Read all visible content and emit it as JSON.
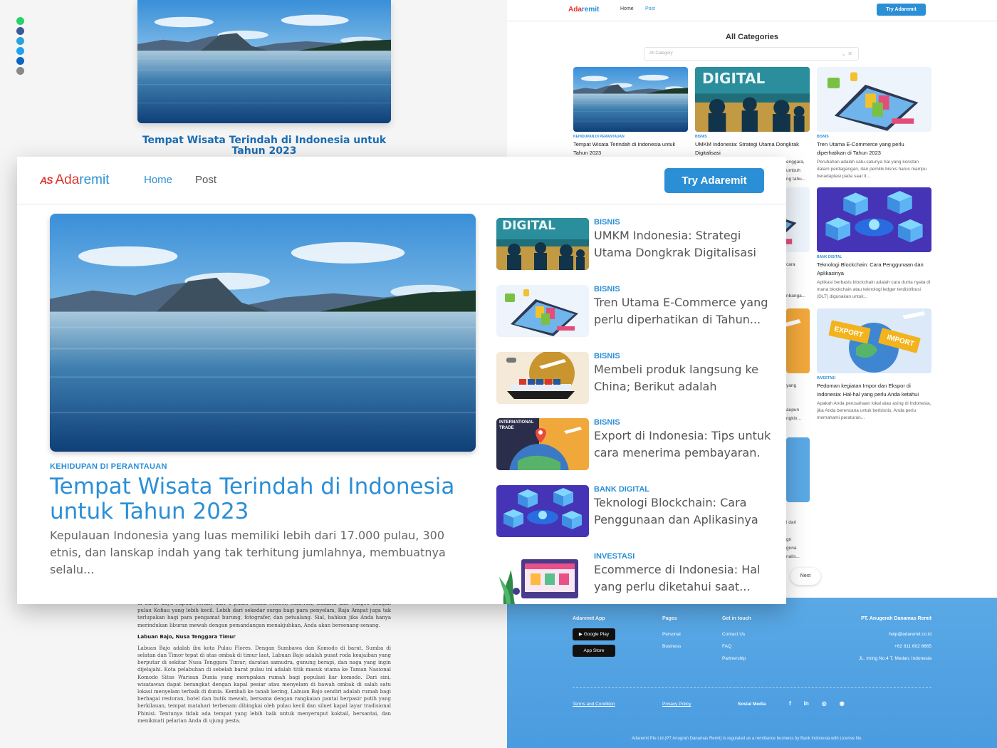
{
  "left_page": {
    "hero_title": "Tempat Wisata Terindah di Indonesia untuk Tahun 2023",
    "body_paragraph_1": "di barat daya Papua. Terdiri dari 4 pulau utama Misool, Salawati, Batanta dan Waigeo dengan pulau Kofiau yang lebih kecil. Lebih dari sekedar surga bagi para penyelam, Raja Ampat juga tak terlupakan bagi para pengamat burung, fotografer, dan petualang. Sial, bahkan jika Anda hanya merindukan liburan mewah dengan pemandangan menakjubkan, Anda akan bersenang-senang.",
    "subheading": "Labuan Bajo, Nusa Tenggara Timur",
    "body_paragraph_2": "Labuan Bajo adalah ibu kota Pulau Flores. Dengan Sumbawa dan Komodo di barat, Sumba di selatan dan Timor tepat di atas ombak di timur laut, Labuan Bajo adalah pusat roda keajaiban yang berputar di sekitar Nusa Tenggara Timur; daratan samudra, gunung berapi, dan naga yang ingin dijelajahi. Kota pelabuhan di sebelah barat pulau ini adalah titik masuk utama ke Taman Nasional Komodo Situs Warisan Dunia yang merupakan rumah bagi populasi liar komodo. Dari sini, wisatawan dapat berangkat dengan kapal pesiar atau menyelam di bawah ombak di salah satu lokasi menyelam terbaik di dunia. Kembali ke tanah kering, Labuan Bajo sendiri adalah rumah bagi berbagai restoran, hotel dan butik mewah, bersama dengan rangkaian pantai berpasir putih yang berkilauan, tempat matahari terbenam dibingkai oleh pulau kecil dan siluet kapal layar tradisional Phinisi. Tentunya tidak ada tempat yang lebih baik untuk menyeruput koktail, bersantai, dan menikmati pelarian Anda di ujung pesta."
  },
  "right_page": {
    "brand_prefix": "Ada",
    "brand_suffix": "remit",
    "nav_home": "Home",
    "nav_post": "Post",
    "try_button": "Try Adaremit",
    "section_title": "All Categories",
    "category_placeholder": "All Category",
    "cards": [
      {
        "category": "KEHIDUPAN DI PERANTAUAN",
        "title": "Tempat Wisata Terindah di Indonesia untuk Tahun 2023",
        "excerpt": ""
      },
      {
        "category": "BISNIS",
        "title": "UMKM Indonesia: Strategi Utama Dongkrak Digitalisasi",
        "excerpt": ""
      },
      {
        "category": "BISNIS",
        "title": "Tren Utama E-Commerce yang perlu diperhatikan di Tahun 2023",
        "excerpt": "Perubahan adalah satu-satunya hal yang konstan dalam perdagangan, dan pemilik bisnis harus mampu beradaptasi pada saat it..."
      },
      {
        "category": "BANK DIGITAL",
        "title": "Teknologi Blockchain: Cara Penggunaan dan Aplikasinya",
        "excerpt": "Aplikasi berbasis blockchain adalah cara dunia nyata di mana blockchain atau teknologi ledger terdistribusi (DLT) digunakan untuk..."
      },
      {
        "category": "INVESTASI",
        "title": "Pedoman kegiatan Impor dan Ekspor di Indonesia: Hal-hal yang perlu Anda ketahui",
        "excerpt": "Apakah Anda perusahaan lokal atau asing di Indonesia, jika Anda berencana untuk berbisnis, Anda perlu memahami peraturan..."
      }
    ],
    "partial_texts": [
      "enggara,",
      "umbuh",
      "ari",
      "ng tahu...",
      "cara",
      "nbanga...",
      "yang",
      "aupun",
      "ngkin...",
      "l dari",
      "gn",
      "guna",
      "nalis..."
    ],
    "export_label": "EXPORT",
    "import_label": "IMPORT",
    "pagination_prev": "0",
    "pagination_next": "Next",
    "footer": {
      "app_heading": "Adaremit App",
      "google_play": "Google Play",
      "app_store": "App Store",
      "pages_heading": "Pages",
      "pages_links": [
        "Personal",
        "Business"
      ],
      "contact_heading": "Get in touch",
      "contact_links": [
        "Contact Us",
        "FAQ",
        "Partnership"
      ],
      "company_heading": "PT. Anugerah Danamas Remit",
      "email": "help@adaremit.co.id",
      "phone": "+62 811 602 8665",
      "address": "JL. Iming No.4 T, Medan, Indonesia",
      "terms": "Terms and Condition",
      "privacy": "Privacy Policy",
      "social_label": "Sosial Media",
      "social_icons": [
        "f",
        "in",
        "◎",
        "◉"
      ],
      "legal": "Adaremit Pte Ltd (PT Anugrah Danamas Remit) is regulated as a remittance business by Bank Indonesia with License No."
    }
  },
  "main_window": {
    "brand_mark": "AS",
    "brand_prefix": "Ada",
    "brand_suffix": "remit",
    "nav_home": "Home",
    "nav_post": "Post",
    "try_button": "Try Adaremit",
    "featured": {
      "category": "KEHIDUPAN DI PERANTAUAN",
      "title": "Tempat Wisata Terindah di Indonesia untuk Tahun 2023",
      "excerpt": "Kepulauan Indonesia yang luas memiliki lebih dari 17.000 pulau, 300 etnis, dan lanskap indah yang tak terhitung jumlahnya, membuatnya selalu..."
    },
    "digital_thumb_label": "DIGITAL",
    "intl_trade_label": "INTERNATIONAL TRADE",
    "posts": [
      {
        "category": "BISNIS",
        "title": "UMKM Indonesia: Strategi Utama Dongkrak Digitalisasi"
      },
      {
        "category": "BISNIS",
        "title": "Tren Utama E-Commerce yang perlu diperhatikan di Tahun..."
      },
      {
        "category": "BISNIS",
        "title": "Membeli produk langsung ke China; Berikut adalah beberap..."
      },
      {
        "category": "BISNIS",
        "title": "Export di Indonesia: Tips untuk cara menerima pembayaran."
      },
      {
        "category": "BANK DIGITAL",
        "title": "Teknologi Blockchain: Cara Penggunaan dan Aplikasinya"
      },
      {
        "category": "INVESTASI",
        "title": "Ecommerce di Indonesia: Hal yang perlu diketahui saat..."
      }
    ]
  },
  "colors": {
    "brand_blue": "#2b8fd6",
    "brand_red": "#e3342f",
    "footer_blue": "#5aa9e6"
  }
}
